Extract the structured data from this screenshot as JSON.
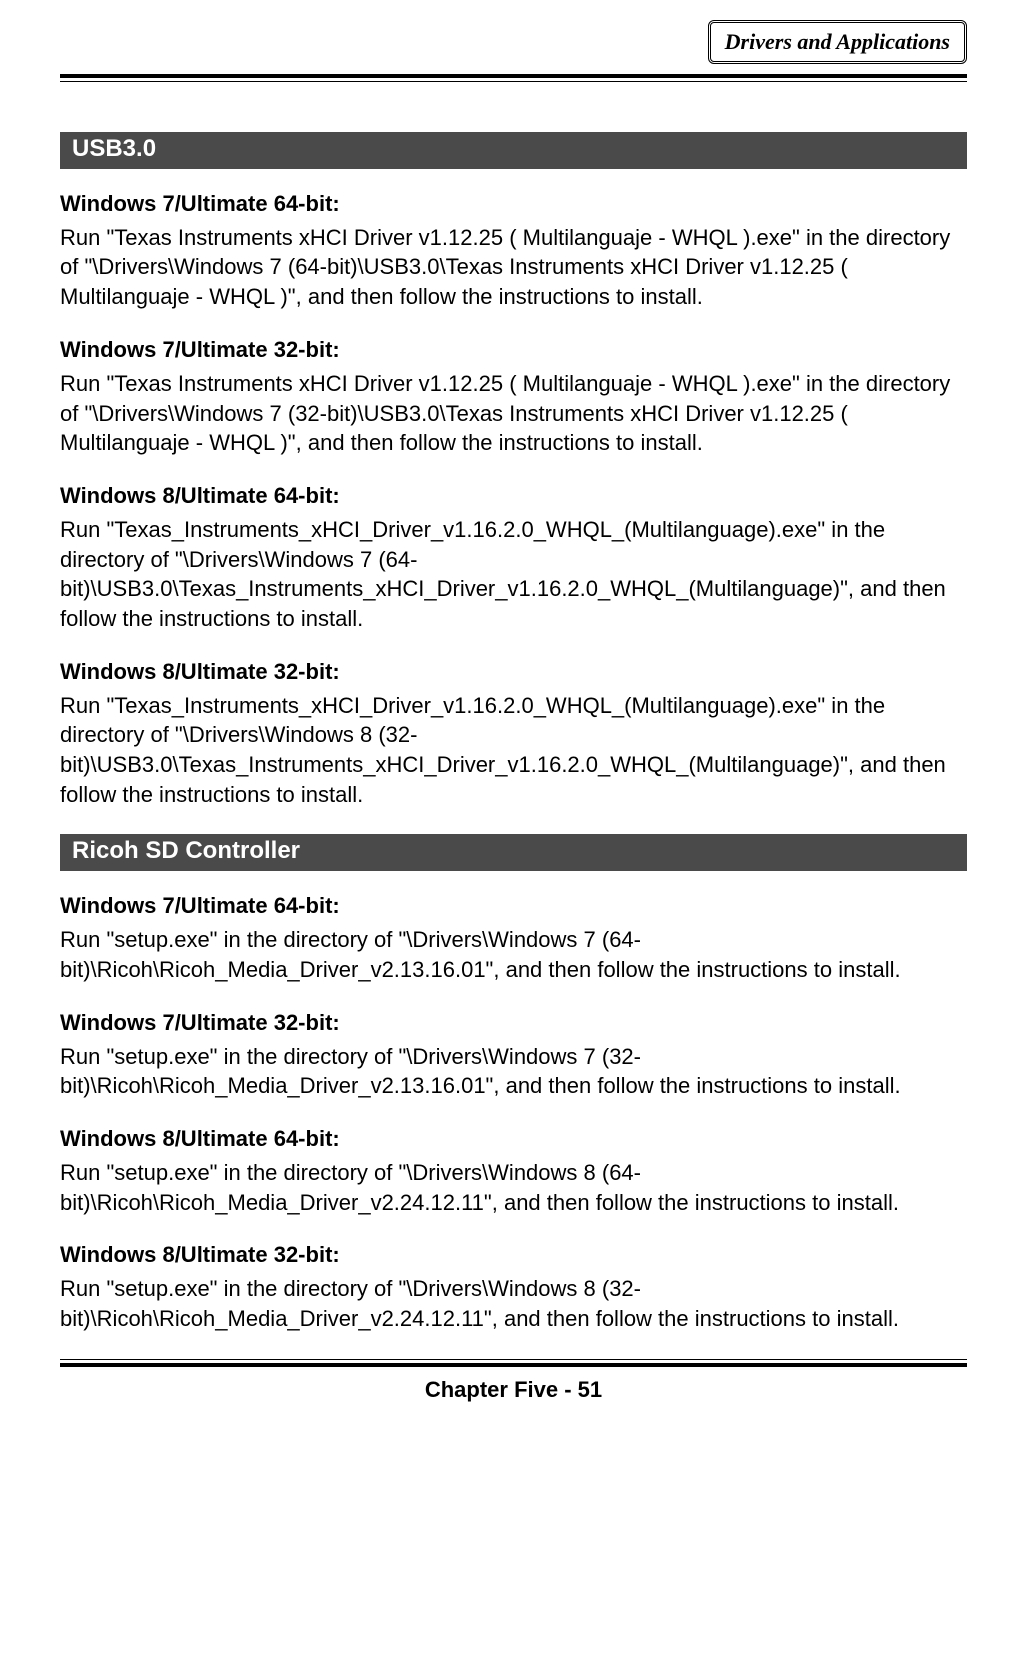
{
  "header": {
    "label": "Drivers and Applications"
  },
  "sections": [
    {
      "title": " USB3.0",
      "entries": [
        {
          "title": "Windows 7/Ultimate 64-bit:",
          "body": "Run \"Texas Instruments xHCI Driver v1.12.25 ( Multilanguaje - WHQL ).exe\" in the directory of \"\\Drivers\\Windows 7 (64-bit)\\USB3.0\\Texas Instruments xHCI Driver v1.12.25 ( Multilanguaje - WHQL )\", and then follow the instructions to install."
        },
        {
          "title": "Windows 7/Ultimate 32-bit:",
          "body": "Run \"Texas Instruments xHCI Driver v1.12.25 ( Multilanguaje - WHQL ).exe\" in the directory of \"\\Drivers\\Windows 7 (32-bit)\\USB3.0\\Texas Instruments xHCI Driver v1.12.25 ( Multilanguaje - WHQL )\", and then follow the instructions to install."
        },
        {
          "title": "Windows 8/Ultimate 64-bit:",
          "body": "Run \"Texas_Instruments_xHCI_Driver_v1.16.2.0_WHQL_(Multilanguage).exe\" in the directory of \"\\Drivers\\Windows 7 (64-bit)\\USB3.0\\Texas_Instruments_xHCI_Driver_v1.16.2.0_WHQL_(Multilanguage)\", and then follow the instructions to install."
        },
        {
          "title": "Windows 8/Ultimate 32-bit:",
          "body": "Run \"Texas_Instruments_xHCI_Driver_v1.16.2.0_WHQL_(Multilanguage).exe\" in the directory of \"\\Drivers\\Windows 8 (32-bit)\\USB3.0\\Texas_Instruments_xHCI_Driver_v1.16.2.0_WHQL_(Multilanguage)\", and then follow the instructions to install."
        }
      ]
    },
    {
      "title": " Ricoh SD Controller",
      "entries": [
        {
          "title": "Windows 7/Ultimate 64-bit:",
          "body": "Run \"setup.exe\" in the directory of \"\\Drivers\\Windows 7 (64-bit)\\Ricoh\\Ricoh_Media_Driver_v2.13.16.01\", and then follow the instructions to install."
        },
        {
          "title": "Windows 7/Ultimate 32-bit:",
          "body": "Run \"setup.exe\" in the directory of \"\\Drivers\\Windows 7 (32-bit)\\Ricoh\\Ricoh_Media_Driver_v2.13.16.01\", and then follow the instructions to install."
        },
        {
          "title": "Windows 8/Ultimate 64-bit:",
          "body": "Run \"setup.exe\" in the directory of \"\\Drivers\\Windows 8 (64-bit)\\Ricoh\\Ricoh_Media_Driver_v2.24.12.11\", and then follow the instructions to install."
        },
        {
          "title": "Windows 8/Ultimate 32-bit:",
          "body": "Run \"setup.exe\" in the directory of \"\\Drivers\\Windows 8 (32-bit)\\Ricoh\\Ricoh_Media_Driver_v2.24.12.11\", and then follow the instructions to install."
        }
      ]
    }
  ],
  "footer": {
    "label": "Chapter Five - 51"
  }
}
